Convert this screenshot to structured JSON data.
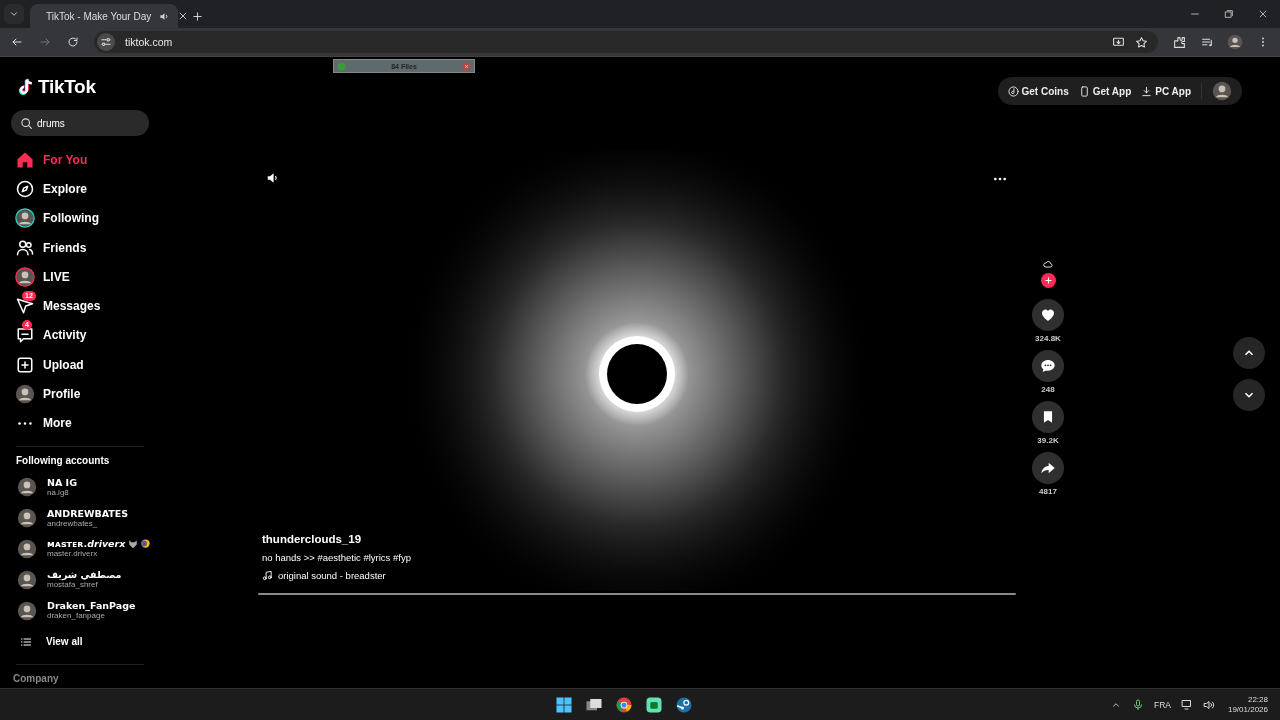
{
  "browser": {
    "tab": {
      "title": "TikTok - Make Your Day",
      "audio": true
    },
    "url": "tiktok.com"
  },
  "overlay_widget": {
    "label": "84 Files"
  },
  "sidebar": {
    "logo": "TikTok",
    "search": {
      "value": "drums"
    },
    "nav": [
      {
        "label": "For You",
        "kind": "home",
        "selected": true
      },
      {
        "label": "Explore",
        "kind": "explore",
        "selected": false
      },
      {
        "label": "Following",
        "kind": "following",
        "selected": false
      },
      {
        "label": "Friends",
        "kind": "friends",
        "selected": false
      },
      {
        "label": "LIVE",
        "kind": "live",
        "selected": false
      },
      {
        "label": "Messages",
        "kind": "messages",
        "badge": "12",
        "selected": false
      },
      {
        "label": "Activity",
        "kind": "activity",
        "badge": "4",
        "selected": false
      },
      {
        "label": "Upload",
        "kind": "upload",
        "selected": false
      },
      {
        "label": "Profile",
        "kind": "profile",
        "selected": false
      },
      {
        "label": "More",
        "kind": "more",
        "selected": false
      }
    ],
    "following_title": "Following accounts",
    "accounts": [
      {
        "name": "NA IG",
        "handle": "na.ig8"
      },
      {
        "name": "ANDREWBATES",
        "handle": "andrewbates_"
      },
      {
        "name": "ᴍᴀsᴛᴇʀ.*driverx*",
        "handle": "master.driverx",
        "emblems": true
      },
      {
        "name": "مصطفي شريف",
        "handle": "mostafa_shref"
      },
      {
        "name": "Draken_FanPage",
        "handle": "draken_fanpage"
      }
    ],
    "view_all": "View all",
    "footer_heading": "Company"
  },
  "header": {
    "links": [
      {
        "label": "Get Coins",
        "kind": "coins"
      },
      {
        "label": "Get App",
        "kind": "phone"
      },
      {
        "label": "PC App",
        "kind": "download"
      }
    ]
  },
  "video": {
    "author": "thunderclouds_19",
    "caption": "no hands >> #aesthetic #lyrics #fyp",
    "sound": "original sound - breadster",
    "actions": [
      {
        "kind": "like",
        "count": "324.8K"
      },
      {
        "kind": "comment",
        "count": "248"
      },
      {
        "kind": "save",
        "count": "39.2K"
      },
      {
        "kind": "share",
        "count": "4817"
      }
    ]
  },
  "taskbar": {
    "apps": [
      {
        "kind": "start"
      },
      {
        "kind": "taskview"
      },
      {
        "kind": "browser"
      },
      {
        "kind": "chat"
      },
      {
        "kind": "steam"
      }
    ],
    "language": "FRA",
    "time": "22:28",
    "date": "19/01/2026"
  }
}
